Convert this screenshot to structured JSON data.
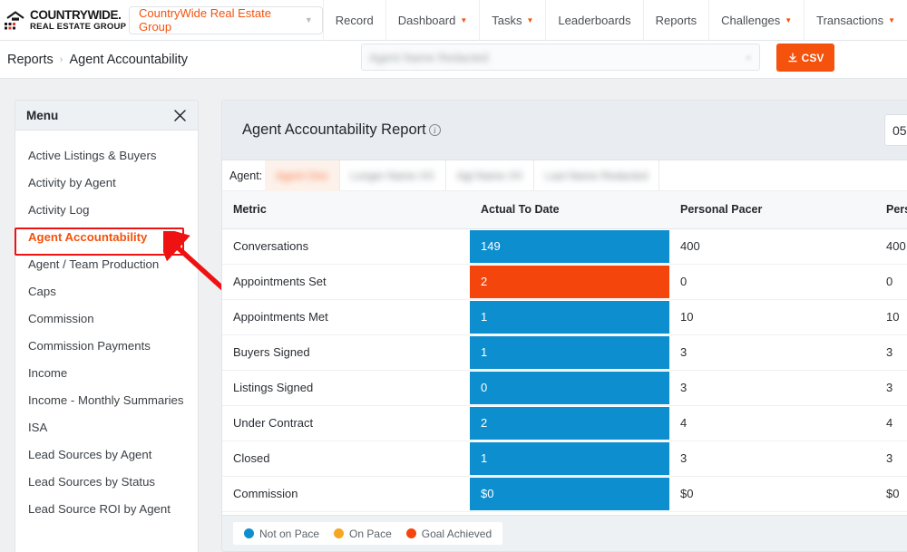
{
  "brand": {
    "logo_line1": "COUNTRYWIDE",
    "logo_dot": ".",
    "logo_line2": "REAL ESTATE GROUP",
    "accent": "#f4520d",
    "logo_red": "#e8342a"
  },
  "topbar": {
    "org_select_value": "CountryWide Real Estate Group",
    "nav": [
      {
        "label": "Record",
        "has_caret": false
      },
      {
        "label": "Dashboard",
        "has_caret": true
      },
      {
        "label": "Tasks",
        "has_caret": true
      },
      {
        "label": "Leaderboards",
        "has_caret": false
      },
      {
        "label": "Reports",
        "has_caret": false
      },
      {
        "label": "Challenges",
        "has_caret": true
      },
      {
        "label": "Transactions",
        "has_caret": true
      }
    ]
  },
  "breadcrumb": {
    "parent": "Reports",
    "separator": "›",
    "current": "Agent Accountability"
  },
  "search": {
    "value_redacted": "Agent Name Redacted",
    "clear_icon": "×"
  },
  "csv_button": {
    "label": "CSV",
    "icon": "download-icon"
  },
  "sidebar": {
    "title": "Menu",
    "close_icon": "×",
    "items": [
      {
        "label": "Active Listings & Buyers",
        "active": false
      },
      {
        "label": "Activity by Agent",
        "active": false
      },
      {
        "label": "Activity Log",
        "active": false
      },
      {
        "label": "Agent Accountability",
        "active": true
      },
      {
        "label": "Agent / Team Production",
        "active": false
      },
      {
        "label": "Caps",
        "active": false
      },
      {
        "label": "Commission",
        "active": false
      },
      {
        "label": "Commission Payments",
        "active": false
      },
      {
        "label": "Income",
        "active": false
      },
      {
        "label": "Income - Monthly Summaries",
        "active": false
      },
      {
        "label": "ISA",
        "active": false
      },
      {
        "label": "Lead Sources by Agent",
        "active": false
      },
      {
        "label": "Lead Sources by Status",
        "active": false
      },
      {
        "label": "Lead Source ROI by Agent",
        "active": false
      }
    ]
  },
  "report": {
    "title": "Agent Accountability Report",
    "info_icon": "i",
    "date_value": "05",
    "agent_filter": {
      "label": "Agent:",
      "chips": [
        {
          "text_redacted": "Agent One",
          "selected": true
        },
        {
          "text_redacted": "Longer Name XX",
          "selected": false
        },
        {
          "text_redacted": "Agt Name XX",
          "selected": false
        },
        {
          "text_redacted": "Last Name Redacted",
          "selected": false
        }
      ]
    },
    "columns": [
      "Metric",
      "Actual To Date",
      "Personal Pacer",
      "Perso"
    ],
    "rows": [
      {
        "metric": "Conversations",
        "actual": "149",
        "pacer": "400",
        "pacer2": "400",
        "status": "not-on-pace"
      },
      {
        "metric": "Appointments Set",
        "actual": "2",
        "pacer": "0",
        "pacer2": "0",
        "status": "goal-achieved"
      },
      {
        "metric": "Appointments Met",
        "actual": "1",
        "pacer": "10",
        "pacer2": "10",
        "status": "not-on-pace"
      },
      {
        "metric": "Buyers Signed",
        "actual": "1",
        "pacer": "3",
        "pacer2": "3",
        "status": "not-on-pace"
      },
      {
        "metric": "Listings Signed",
        "actual": "0",
        "pacer": "3",
        "pacer2": "3",
        "status": "not-on-pace"
      },
      {
        "metric": "Under Contract",
        "actual": "2",
        "pacer": "4",
        "pacer2": "4",
        "status": "not-on-pace"
      },
      {
        "metric": "Closed",
        "actual": "1",
        "pacer": "3",
        "pacer2": "3",
        "status": "not-on-pace"
      },
      {
        "metric": "Commission",
        "actual": "$0",
        "pacer": "$0",
        "pacer2": "$0",
        "status": "not-on-pace"
      }
    ],
    "legend": [
      {
        "label": "Not on Pace",
        "color": "#0d8ecf"
      },
      {
        "label": "On Pace",
        "color": "#f5a623"
      },
      {
        "label": "Goal Achieved",
        "color": "#f4460c"
      }
    ]
  },
  "annotation": {
    "highlight_color": "#ef1212",
    "target": "Agent Accountability"
  }
}
